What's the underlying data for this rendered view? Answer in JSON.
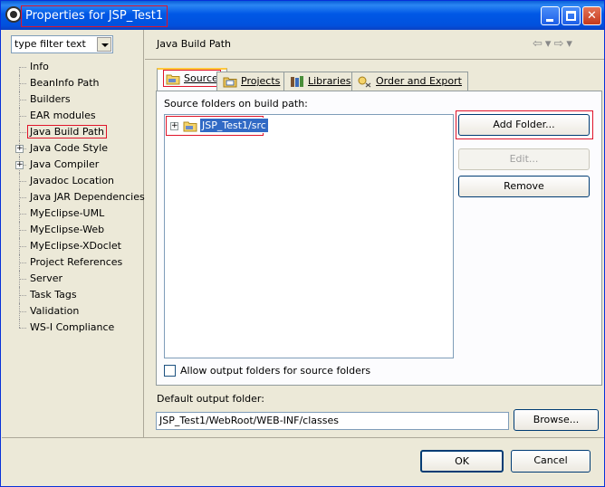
{
  "window": {
    "title": "Properties for JSP_Test1"
  },
  "filter": {
    "value": "type filter text"
  },
  "tree": {
    "items": [
      {
        "label": "Info",
        "expandable": false
      },
      {
        "label": "BeanInfo Path",
        "expandable": false
      },
      {
        "label": "Builders",
        "expandable": false
      },
      {
        "label": "EAR modules",
        "expandable": false
      },
      {
        "label": "Java Build Path",
        "expandable": false,
        "selected": true
      },
      {
        "label": "Java Code Style",
        "expandable": true
      },
      {
        "label": "Java Compiler",
        "expandable": true
      },
      {
        "label": "Javadoc Location",
        "expandable": false
      },
      {
        "label": "Java JAR Dependencies",
        "expandable": false
      },
      {
        "label": "MyEclipse-UML",
        "expandable": false
      },
      {
        "label": "MyEclipse-Web",
        "expandable": false
      },
      {
        "label": "MyEclipse-XDoclet",
        "expandable": false
      },
      {
        "label": "Project References",
        "expandable": false
      },
      {
        "label": "Server",
        "expandable": false
      },
      {
        "label": "Task Tags",
        "expandable": false
      },
      {
        "label": "Validation",
        "expandable": false
      },
      {
        "label": "WS-I Compliance",
        "expandable": false
      }
    ]
  },
  "page": {
    "title": "Java Build Path",
    "tabs": [
      {
        "label": "Source",
        "icon": "source-folder-icon",
        "active": true
      },
      {
        "label": "Projects",
        "icon": "projects-icon",
        "active": false
      },
      {
        "label": "Libraries",
        "icon": "libraries-icon",
        "active": false
      },
      {
        "label": "Order and Export",
        "icon": "order-export-icon",
        "active": false
      }
    ],
    "source_label": "Source folders on build path:",
    "source_folders": [
      {
        "label": "JSP_Test1/src",
        "selected": true
      }
    ],
    "buttons": {
      "add_folder": "Add Folder...",
      "edit": "Edit...",
      "remove": "Remove"
    },
    "allow_output_label": "Allow output folders for source folders",
    "allow_output_checked": false,
    "default_output_label": "Default output folder:",
    "default_output_value": "JSP_Test1/WebRoot/WEB-INF/classes",
    "browse_label": "Browse..."
  },
  "footer": {
    "ok_label": "OK",
    "cancel_label": "Cancel"
  },
  "colors": {
    "highlight_border": "#e0142a",
    "selection": "#316ac5",
    "titlebar": "#0058e6"
  }
}
